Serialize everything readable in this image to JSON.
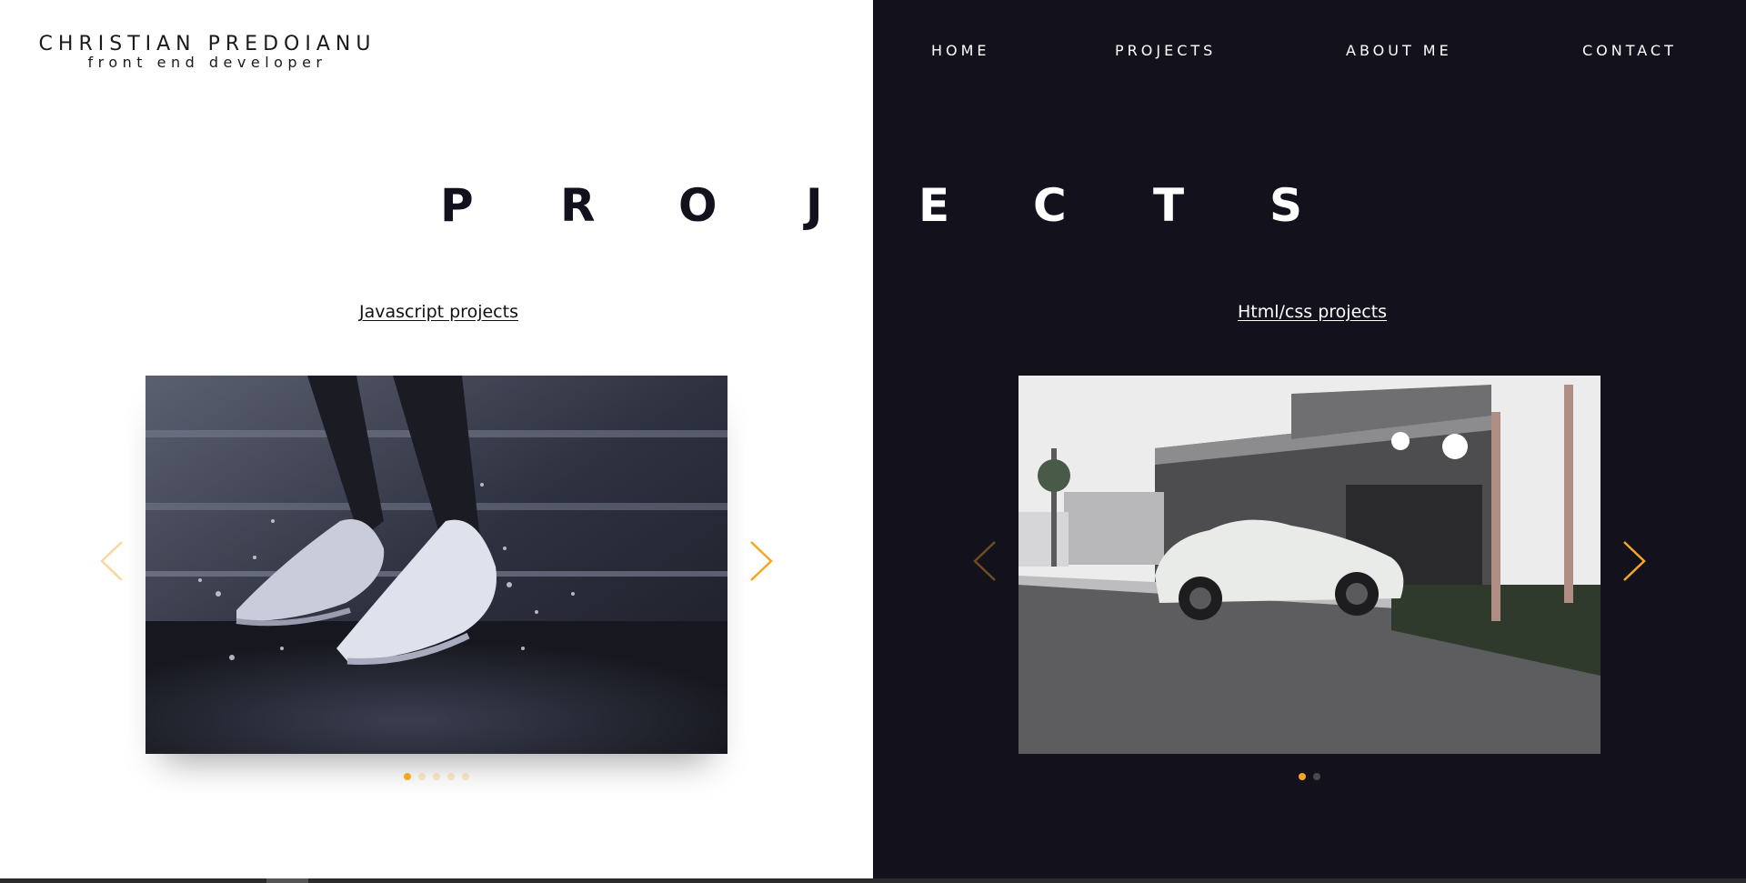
{
  "brand": {
    "name": "CHRISTIAN PREDOIANU",
    "role": "front end developer"
  },
  "nav": {
    "home": "HOME",
    "projects": "PROJECTS",
    "about": "ABOUT ME",
    "contact": "CONTACT"
  },
  "page_title_letters": [
    "P",
    "R",
    "O",
    "J",
    "E",
    "C",
    "T",
    "S"
  ],
  "sections": {
    "javascript": {
      "heading": "Javascript projects",
      "slide_count": 5,
      "active_slide": 1
    },
    "htmlcss": {
      "heading": "Html/css projects",
      "slide_count": 2,
      "active_slide": 1
    }
  },
  "colors": {
    "light_bg": "#ffffff",
    "dark_bg": "#13111c",
    "accent": "#f5a623",
    "text_dark": "#13111c",
    "text_light": "#ffffff"
  },
  "icons": {
    "prev": "chevron-left-icon",
    "next": "chevron-right-icon"
  }
}
